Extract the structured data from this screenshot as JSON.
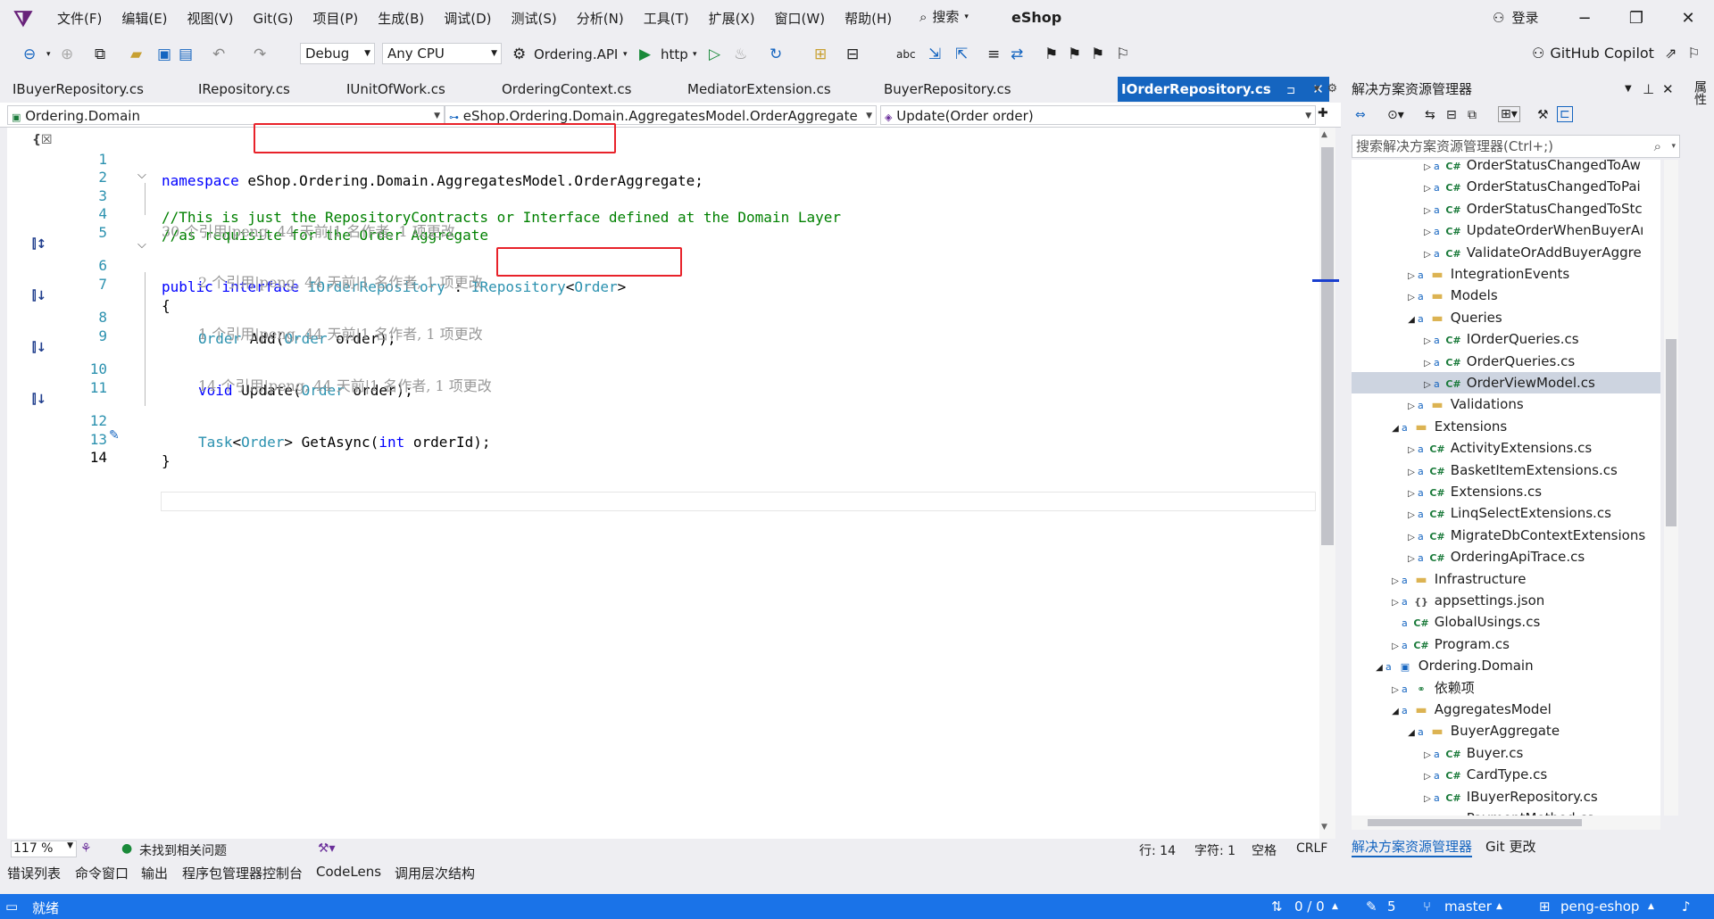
{
  "menubar": {
    "items": [
      "文件(F)",
      "编辑(E)",
      "视图(V)",
      "Git(G)",
      "项目(P)",
      "生成(B)",
      "调试(D)",
      "测试(S)",
      "分析(N)",
      "工具(T)",
      "扩展(X)",
      "窗口(W)",
      "帮助(H)"
    ],
    "search_label": "搜索",
    "solution_name": "eShop",
    "login_label": "登录"
  },
  "toolbar": {
    "config": "Debug",
    "platform": "Any CPU",
    "startup_project": "Ordering.API",
    "launch_profile": "http",
    "copilot_label": "GitHub Copilot"
  },
  "doc_tabs": [
    "IBuyerRepository.cs",
    "IRepository.cs",
    "IUnitOfWork.cs",
    "OrderingContext.cs",
    "MediatorExtension.cs",
    "BuyerRepository.cs",
    "IOrderRepository.cs"
  ],
  "doc_tab_close": "✕",
  "navbar": {
    "project": "Ordering.Domain",
    "type": "eShop.Ordering.Domain.AggregatesModel.OrderAggregate",
    "member": "Update(Order order)"
  },
  "code": {
    "line_numbers": [
      "1",
      "2",
      "3",
      "4",
      "5",
      "6",
      "7",
      "8",
      "9",
      "10",
      "11",
      "12",
      "13",
      "14"
    ],
    "l1_kw": "namespace",
    "l1_ns": "eShop.Ordering.Domain.AggregatesModel.",
    "l1_rest": "OrderAggregate;",
    "l3": "//This is just the RepositoryContracts or Interface defined at the Domain Layer",
    "l4": "//as requisite for the Order Aggregate",
    "lens_interface": "30 个引用|peng, 44 天前|1 名作者, 1 项更改",
    "l6_kw": "public interface",
    "l6_name": "IOrderRepository",
    "l6_colon": ":",
    "l6_base": "IRepository",
    "l6_lt": "<",
    "l6_arg": "Order",
    "l6_gt": ">",
    "l7": "{",
    "lens_add": "2 个引用|peng, 44 天前|1 名作者, 1 项更改",
    "l8_type": "Order",
    "l8_name": "Add(",
    "l8_ptype": "Order",
    "l8_rest": "order);",
    "lens_update": "1 个引用|peng, 44 天前|1 名作者, 1 项更改",
    "l10_kw": "void",
    "l10_name": "Update(",
    "l10_ptype": "Order",
    "l10_rest": "order);",
    "lens_get": "14 个引用|peng, 44 天前|1 名作者, 1 项更改",
    "l12_type": "Task",
    "l12_lt": "<",
    "l12_arg": "Order",
    "l12_gt": "> GetAsync(",
    "l12_kw": "int",
    "l12_rest": "orderId);",
    "l13": "}"
  },
  "editor_status": {
    "zoom": "117 %",
    "issues": "未找到相关问题",
    "line": "行: 14",
    "col": "字符: 1",
    "space": "空格",
    "eol": "CRLF"
  },
  "bottom_tabs": [
    "错误列表",
    "命令窗口",
    "输出",
    "程序包管理器控制台",
    "CodeLens",
    "调用层次结构"
  ],
  "statusbar": {
    "ready": "就绪",
    "sync": "0 / 0",
    "changes": "5",
    "branch": "master",
    "repo": "peng-eshop"
  },
  "solution_explorer": {
    "title": "解决方案资源管理器",
    "search_placeholder": "搜索解决方案资源管理器(Ctrl+;)",
    "tree": [
      {
        "label": "OrderStatusChangedToAw",
        "icon": "cs"
      },
      {
        "label": "OrderStatusChangedToPai",
        "icon": "cs"
      },
      {
        "label": "OrderStatusChangedToStc",
        "icon": "cs"
      },
      {
        "label": "UpdateOrderWhenBuyerAı",
        "icon": "cs"
      },
      {
        "label": "ValidateOrAddBuyerAggre",
        "icon": "cs"
      },
      {
        "label": "IntegrationEvents",
        "icon": "folder"
      },
      {
        "label": "Models",
        "icon": "folder"
      },
      {
        "label": "Queries",
        "icon": "folder"
      },
      {
        "label": "IOrderQueries.cs",
        "icon": "cs"
      },
      {
        "label": "OrderQueries.cs",
        "icon": "cs"
      },
      {
        "label": "OrderViewModel.cs",
        "icon": "cs"
      },
      {
        "label": "Validations",
        "icon": "folder"
      },
      {
        "label": "Extensions",
        "icon": "folder"
      },
      {
        "label": "ActivityExtensions.cs",
        "icon": "cs"
      },
      {
        "label": "BasketItemExtensions.cs",
        "icon": "cs"
      },
      {
        "label": "Extensions.cs",
        "icon": "cs"
      },
      {
        "label": "LinqSelectExtensions.cs",
        "icon": "cs"
      },
      {
        "label": "MigrateDbContextExtensions",
        "icon": "cs"
      },
      {
        "label": "OrderingApiTrace.cs",
        "icon": "cs"
      },
      {
        "label": "Infrastructure",
        "icon": "folder"
      },
      {
        "label": "appsettings.json",
        "icon": "json"
      },
      {
        "label": "GlobalUsings.cs",
        "icon": "cs"
      },
      {
        "label": "Program.cs",
        "icon": "cs"
      },
      {
        "label": "Ordering.Domain",
        "icon": "proj"
      },
      {
        "label": "依赖项",
        "icon": "deps"
      },
      {
        "label": "AggregatesModel",
        "icon": "folder"
      },
      {
        "label": "BuyerAggregate",
        "icon": "folder"
      },
      {
        "label": "Buyer.cs",
        "icon": "cs"
      },
      {
        "label": "CardType.cs",
        "icon": "cs"
      },
      {
        "label": "IBuyerRepository.cs",
        "icon": "cs"
      },
      {
        "label": "PaymentMethod.cs",
        "icon": "cs"
      }
    ],
    "tab_active": "解决方案资源管理器",
    "tab_git": "Git 更改"
  },
  "right_rail_label": "属性",
  "icons": [
    "vs-logo-icon",
    "search-icon",
    "back-icon",
    "forward-icon",
    "save-icon",
    "undo-icon",
    "redo-icon",
    "play-icon",
    "copilot-icon",
    "close-icon",
    "pin-icon"
  ]
}
